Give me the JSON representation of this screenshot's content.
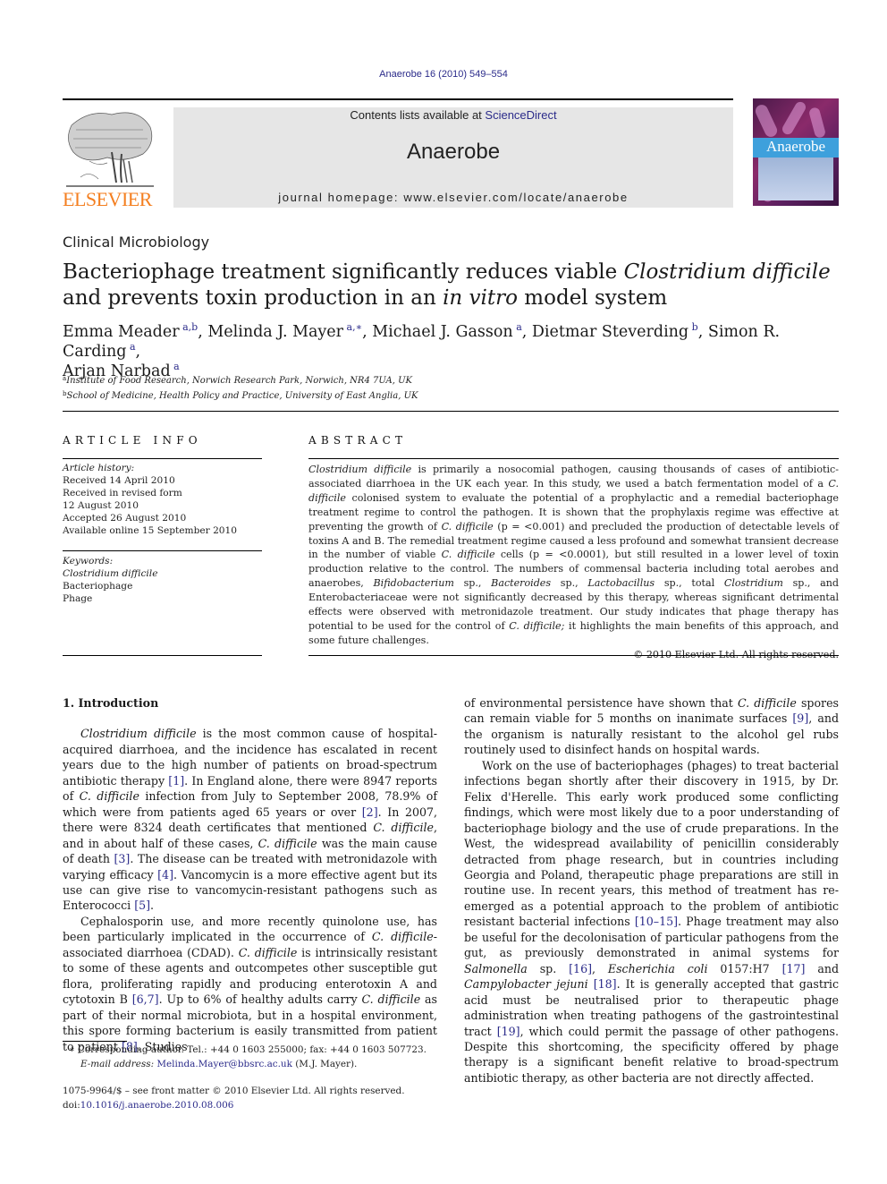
{
  "citation": "Anaerobe 16 (2010) 549–554",
  "header": {
    "publisher": "ELSEVIER",
    "contents_prefix": "Contents lists available at ",
    "contents_link": "ScienceDirect",
    "journal_title": "Anaerobe",
    "homepage_prefix": "journal homepage: ",
    "homepage_url": "www.elsevier.com/locate/anaerobe",
    "cover_title": "Anaerobe",
    "colors": {
      "publisher_orange": "#f47f20",
      "link_blue": "#2b2b8a",
      "masthead_grey": "#e6e6e6",
      "cover_band": "#3ea0dc"
    }
  },
  "section_label": "Clinical Microbiology",
  "title": {
    "part1": "Bacteriophage treatment significantly reduces viable ",
    "italic1": "Clostridium difficile",
    "part2": " and prevents toxin production in an ",
    "italic2": "in vitro",
    "part3": " model system"
  },
  "authors": [
    {
      "name": "Emma Meader",
      "sup": "a,b",
      "sep": ", "
    },
    {
      "name": "Melinda J. Mayer",
      "sup": "a,∗",
      "sep": ", "
    },
    {
      "name": "Michael J. Gasson",
      "sup": "a",
      "sep": ", "
    },
    {
      "name": "Dietmar Steverding",
      "sup": "b",
      "sep": ", "
    },
    {
      "name": "Simon R. Carding",
      "sup": "a",
      "sep": ","
    },
    {
      "name": "Arjan Narbad",
      "sup": "a",
      "sep": ""
    }
  ],
  "affiliations": [
    {
      "key": "a",
      "text": "Institute of Food Research, Norwich Research Park, Norwich, NR4 7UA, UK"
    },
    {
      "key": "b",
      "text": "School of Medicine, Health Policy and Practice, University of East Anglia, UK"
    }
  ],
  "article_info": {
    "heading": "ARTICLE INFO",
    "history_label": "Article history:",
    "history": [
      "Received 14 April 2010",
      "Received in revised form",
      "12 August 2010",
      "Accepted 26 August 2010",
      "Available online 15 September 2010"
    ],
    "keywords_label": "Keywords:",
    "keywords": [
      "Clostridium difficile",
      "Bacteriophage",
      "Phage"
    ]
  },
  "abstract": {
    "heading": "ABSTRACT",
    "s1_it": "Clostridium difficile",
    "s1": " is primarily a nosocomial pathogen, causing thousands of cases of antibiotic-associated diarrhoea in the UK each year. In this study, we used a batch fermentation model of a ",
    "s2_it": "C. difficile",
    "s2": " colonised system to evaluate the potential of a prophylactic and a remedial bacteriophage treatment regime to control the pathogen. It is shown that the prophylaxis regime was effective at preventing the growth of ",
    "s3_it": "C. difficile",
    "s3": " (p = <0.001) and precluded the production of detectable levels of toxins A and B. The remedial treatment regime caused a less profound and somewhat transient decrease in the number of viable ",
    "s4_it": "C. difficile",
    "s4": " cells (p = <0.0001), but still resulted in a lower level of toxin production relative to the control. The numbers of commensal bacteria including total aerobes and anaerobes, ",
    "s5_it": "Bifidobacterium",
    "s5": " sp., ",
    "s6_it": "Bacteroides",
    "s6": " sp., ",
    "s7_it": "Lactobacillus",
    "s7": " sp., total ",
    "s8_it": "Clostridium",
    "s8": " sp., and Enterobacteriaceae were not significantly decreased by this therapy, whereas significant detrimental effects were observed with metronidazole treatment. Our study indicates that phage therapy has potential to be used for the control of ",
    "s9_it": "C. difficile;",
    "s9": " it highlights the main benefits of this approach, and some future challenges.",
    "copyright": "© 2010 Elsevier Ltd. All rights reserved."
  },
  "intro": {
    "heading": "1.  Introduction",
    "p1": {
      "a_it": "Clostridium difficile",
      "a": " is the most common cause of hospital-acquired diarrhoea, and the incidence has escalated in recent years due to the high number of patients on broad-spectrum antibiotic therapy ",
      "r1": "[1]",
      "b": ". In England alone, there were 8947 reports of ",
      "b_it": "C. difficile",
      "c": " infection from July to September 2008, 78.9% of which were from patients aged 65 years or over ",
      "r2": "[2]",
      "d": ". In 2007, there were 8324 death certificates that mentioned ",
      "d_it": "C. difficile",
      "e": ", and in about half of these cases, ",
      "e_it": "C. difficile",
      "f": " was the main cause of death ",
      "r3": "[3]",
      "g": ". The disease can be treated with metronidazole with varying efficacy ",
      "r4": "[4]",
      "h": ". Vancomycin is a more effective agent but its use can give rise to vancomycin-resistant pathogens such as Enterococci ",
      "r5": "[5]",
      "i": "."
    },
    "p2": {
      "a": "Cephalosporin use, and more recently quinolone use, has been particularly implicated in the occurrence of ",
      "a_it": "C. difficile",
      "b": "-associated diarrhoea (CDAD). ",
      "b_it": "C. difficile",
      "c": " is intrinsically resistant to some of these agents and outcompetes other susceptible gut flora, proliferating rapidly and producing enterotoxin A and cytotoxin B ",
      "r1": "[6,7]",
      "d": ". Up to 6% of healthy adults carry ",
      "d_it": "C. difficile",
      "e": " as part of their normal microbiota, but in a hospital environment, this spore forming bacterium is easily transmitted from patient to patient ",
      "r2": "[8]",
      "f": ". Studies of environmental persistence have shown that ",
      "f_it": "C. difficile",
      "g": " spores can remain viable for 5 months on inanimate surfaces ",
      "r3": "[9]",
      "h": ", and the organism is naturally resistant to the alcohol gel rubs routinely used to disinfect hands on hospital wards."
    },
    "p3": {
      "a": "Work on the use of bacteriophages (phages) to treat bacterial infections began shortly after their discovery in 1915, by Dr. Felix d'Herelle. This early work produced some conflicting findings, which were most likely due to a poor understanding of bacteriophage biology and the use of crude preparations. In the West, the widespread availability of penicillin considerably detracted from phage research, but in countries including Georgia and Poland, therapeutic phage preparations are still in routine use. In recent years, this method of treatment has re-emerged as a potential approach to the problem of antibiotic resistant bacterial infections ",
      "r1": "[10–15]",
      "b": ". Phage treatment may also be useful for the decolonisation of particular pathogens from the gut, as previously demonstrated in animal systems for ",
      "b_it": "Salmonella",
      "c": " sp. ",
      "r2": "[16]",
      "c2": ", ",
      "c_it": "Escherichia coli",
      "d": " 0157:H7 ",
      "r3": "[17]",
      "e": " and ",
      "e_it": "Campylobacter jejuni",
      "f": " ",
      "r4": "[18]",
      "g": ". It is generally accepted that gastric acid must be neutralised prior to therapeutic phage administration when treating pathogens of the gastrointestinal tract ",
      "r5": "[19]",
      "h": ", which could permit the passage of other pathogens. Despite this shortcoming, the specificity offered by phage therapy is a significant benefit relative to broad-spectrum antibiotic therapy, as other bacteria are not directly affected."
    }
  },
  "footnote": {
    "marker": "∗",
    "text": " Corresponding author. Tel.: +44 0 1603 255000; fax: +44 0 1603 507723.",
    "email_label": "E-mail address:",
    "email": "Melinda.Mayer@bbsrc.ac.uk",
    "email_suffix": " (M.J. Mayer)."
  },
  "front_matter": {
    "issn_line": "1075-9964/$ – see front matter © 2010 Elsevier Ltd. All rights reserved.",
    "doi_label": "doi:",
    "doi": "10.1016/j.anaerobe.2010.08.006"
  }
}
